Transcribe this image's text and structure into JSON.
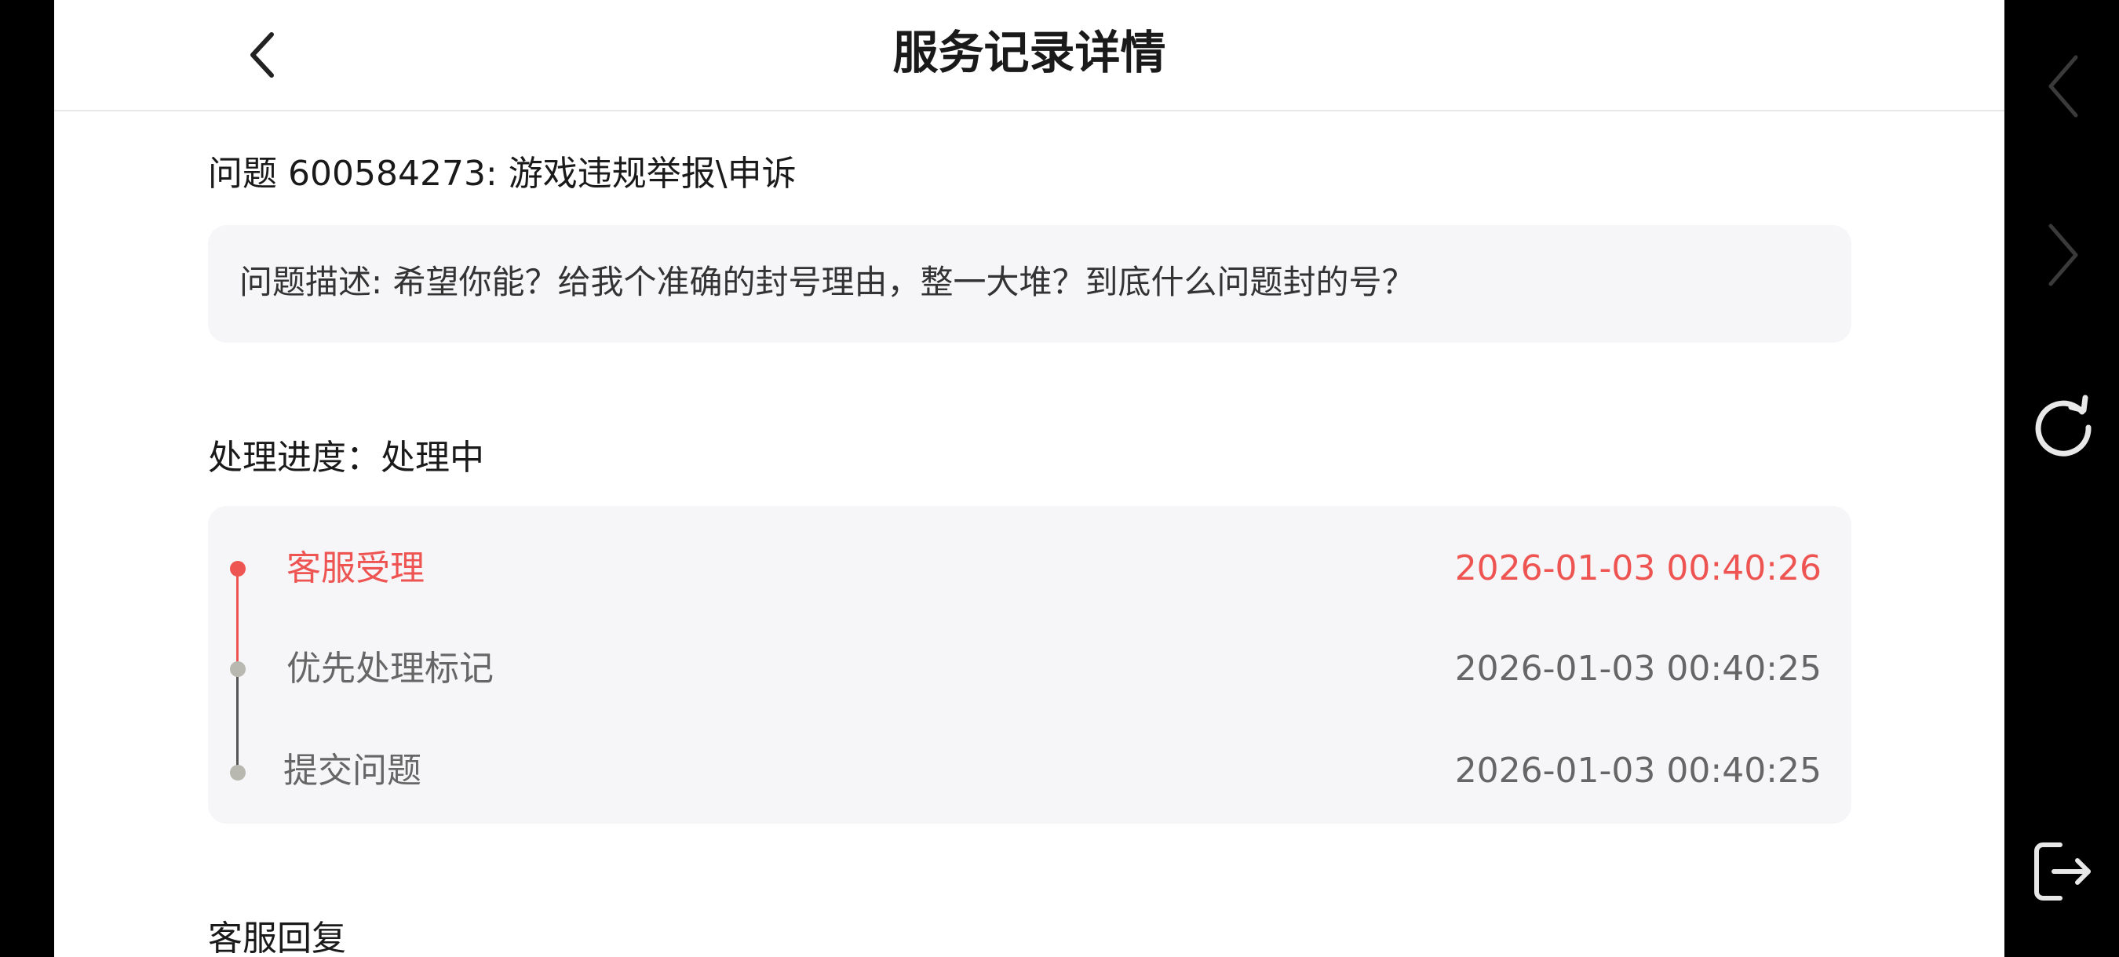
{
  "header": {
    "title": "服务记录详情",
    "back_icon": "chevron-left-icon"
  },
  "problem": {
    "heading": "问题 600584273:   游戏违规举报\\申诉",
    "description": "问题描述: 希望你能？给我个准确的封号理由，整一大堆？到底什么问题封的号？"
  },
  "progress": {
    "heading": "处理进度：处理中",
    "steps": [
      {
        "label": "客服受理",
        "time": "2026-01-03 00:40:26",
        "active": true
      },
      {
        "label": "优先处理标记",
        "time": "2026-01-03 00:40:25",
        "active": false
      },
      {
        "label": "提交问题",
        "time": "2026-01-03 00:40:25",
        "active": false
      }
    ]
  },
  "reply": {
    "heading": "客服回复"
  },
  "side_nav": {
    "icons": [
      "chevron-left-icon",
      "chevron-right-icon",
      "refresh-icon",
      "exit-icon"
    ]
  },
  "colors": {
    "active": "#ee5451",
    "inactive_text": "#666666",
    "inactive_dot": "#b8b8b0",
    "card_bg": "#f6f6f8"
  }
}
